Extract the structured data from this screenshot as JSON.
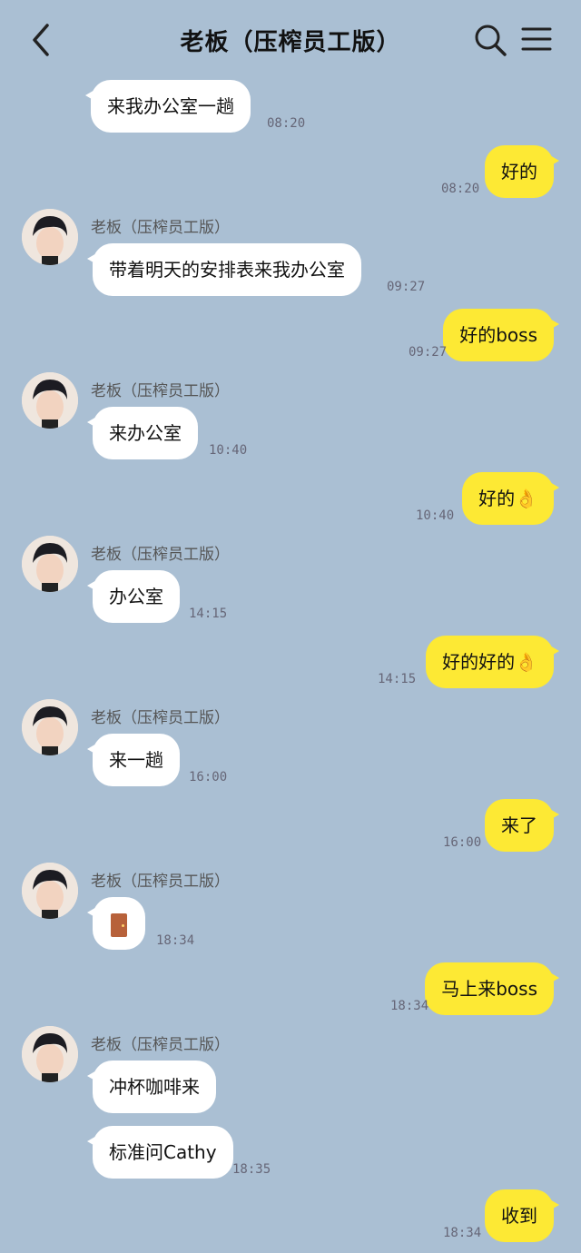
{
  "header": {
    "title": "老板（压榨员工版）"
  },
  "contact": {
    "name": "老板（压榨员工版）"
  },
  "messages": [
    {
      "side": "left",
      "text": "来我办公室一趟",
      "time": "08:20"
    },
    {
      "side": "right",
      "text": "好的",
      "time": "08:20"
    },
    {
      "side": "left",
      "text": "带着明天的安排表来我办公室",
      "time": "09:27"
    },
    {
      "side": "right",
      "text": "好的boss",
      "time": "09:27"
    },
    {
      "side": "left",
      "text": "来办公室",
      "time": "10:40"
    },
    {
      "side": "right",
      "text": "好的👌",
      "time": "10:40"
    },
    {
      "side": "left",
      "text": "办公室",
      "time": "14:15"
    },
    {
      "side": "right",
      "text": "好的好的👌",
      "time": "14:15"
    },
    {
      "side": "left",
      "text": "来一趟",
      "time": "16:00"
    },
    {
      "side": "right",
      "text": "来了",
      "time": "16:00"
    },
    {
      "side": "left",
      "icon": "door-emoji-icon",
      "time": "18:34"
    },
    {
      "side": "right",
      "text": "马上来boss",
      "time": "18:34"
    },
    {
      "side": "left",
      "text": "冲杯咖啡来"
    },
    {
      "side": "left",
      "text": "标准问Cathy",
      "time": "18:35"
    },
    {
      "side": "right",
      "text": "收到",
      "time": "18:34"
    }
  ]
}
